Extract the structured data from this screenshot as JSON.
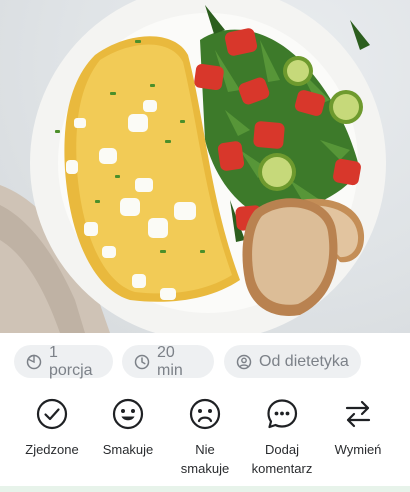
{
  "photo": {
    "alt_icon": "omelette-salad-photo"
  },
  "chips": [
    {
      "icon": "portion-icon",
      "label": "1 porcja"
    },
    {
      "icon": "clock-icon",
      "label": "20 min"
    },
    {
      "icon": "dietitian-icon",
      "label": "Od dietetyka"
    }
  ],
  "actions": [
    {
      "icon": "check-circle-icon",
      "label": "Zjedzone"
    },
    {
      "icon": "smile-icon",
      "label": "Smakuje"
    },
    {
      "icon": "frown-icon",
      "label": "Nie\nsmakuje"
    },
    {
      "icon": "comment-icon",
      "label": "Dodaj\nkomentarz"
    },
    {
      "icon": "swap-icon",
      "label": "Wymień"
    }
  ],
  "colors": {
    "accent_strip": "#e7f3ea",
    "chip_bg": "#eef0f2",
    "chip_text": "#7c8188"
  }
}
